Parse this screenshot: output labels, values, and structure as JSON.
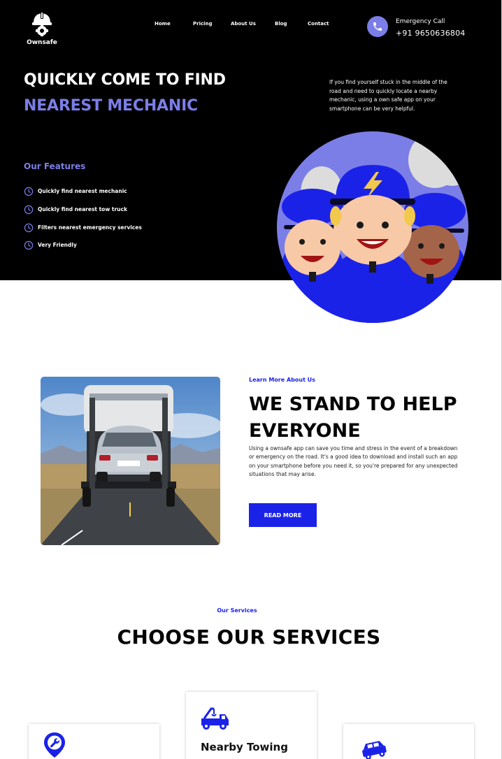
{
  "brand": {
    "name": "Ownsafe",
    "logo_icon": "helmet-gear-icon"
  },
  "nav": {
    "items": [
      {
        "label": "Home"
      },
      {
        "label": "Pricing"
      },
      {
        "label": "About Us"
      },
      {
        "label": "Blog"
      },
      {
        "label": "Contact"
      }
    ]
  },
  "emergency": {
    "label": "Emergency Call",
    "phone": "+91 9650636804",
    "icon": "phone-icon"
  },
  "hero": {
    "title_line1": "QUICKLY COME TO FIND",
    "title_line2": "NEAREST MECHANIC",
    "description": "If you find yourself stuck in the middle of the road and need to quickly locate a nearby mechanic, using a  own safe app on your smartphone can be very helpful."
  },
  "features": {
    "heading": "Our Features",
    "items": [
      {
        "label": "Quickly find nearest mechanic",
        "icon": "clock-icon"
      },
      {
        "label": "Quickly find nearest tow truck",
        "icon": "clock-icon"
      },
      {
        "label": "Filters nearest emergency services",
        "icon": "clock-icon"
      },
      {
        "label": "Very Friendly",
        "icon": "clock-icon"
      }
    ]
  },
  "about": {
    "eyebrow": "Learn More About Us",
    "title": "WE STAND TO HELP EVERYONE",
    "description": "Using a ownsafe app can save you time and stress in the event of a breakdown or emergency on the road. It's a good idea to download and install such an app on your smartphone before you need it, so you're prepared for any unexpected situations that may arise.",
    "button_label": "READ MORE"
  },
  "services": {
    "eyebrow": "Our Services",
    "title": "CHOOSE OUR SERVICES",
    "cards": [
      {
        "title": "",
        "icon": "wrench-location-icon"
      },
      {
        "title": "Nearby Towing",
        "icon": "tow-truck-icon"
      },
      {
        "title": "",
        "icon": "car-crash-icon"
      }
    ]
  },
  "colors": {
    "accent": "#1b22e8",
    "lavender": "#7b7ee6",
    "hero_bg": "#000000"
  }
}
